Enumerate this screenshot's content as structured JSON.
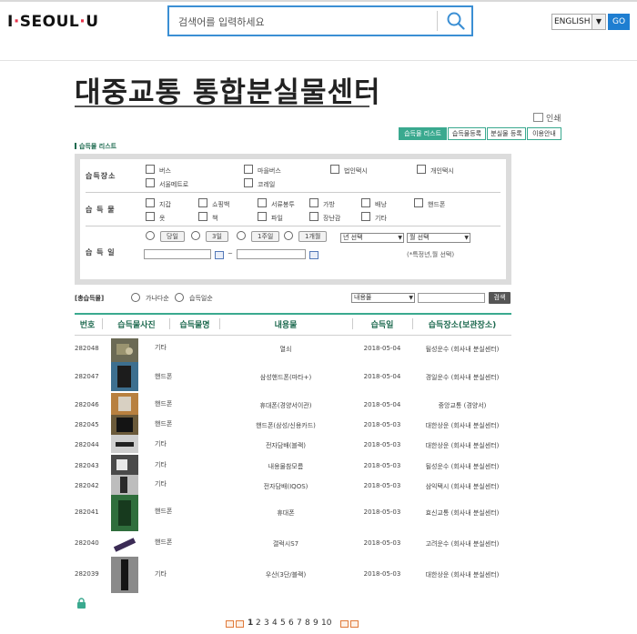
{
  "header": {
    "logo_text": "I·SEOUL·U",
    "logo_i": "I",
    "logo_seoul": "SEOUL",
    "logo_u": "U",
    "search_placeholder": "검색어를 입력하세요",
    "language": "ENGLISH",
    "go_label": "GO"
  },
  "page": {
    "title": "대중교통 통합분실물센터",
    "print_label": "인쇄",
    "section_label": "습득물 리스트"
  },
  "tabs": [
    {
      "label": "습득물 리스트",
      "active": true
    },
    {
      "label": "습득물등록",
      "active": false
    },
    {
      "label": "분실물 등록",
      "active": false
    },
    {
      "label": "이용안내",
      "active": false
    }
  ],
  "search": {
    "place_label": "습득장소",
    "places": [
      "버스",
      "마을버스",
      "법인택시",
      "개인택시",
      "서울메트로",
      "코레일"
    ],
    "item_label": "습 득 물",
    "items": [
      "지갑",
      "쇼핑백",
      "서류봉투",
      "가방",
      "배낭",
      "핸드폰",
      "옷",
      "책",
      "파일",
      "장난감",
      "기타"
    ],
    "date_label": "습 득 일",
    "date_options": [
      "당일",
      "3일",
      "1주일",
      "1개월"
    ],
    "year_select": "년 선택",
    "month_select": "월 선택",
    "tilde": "~",
    "hint": "(*특정년,월 선택)"
  },
  "filter": {
    "label": "[총습득물]",
    "sort_options": [
      "가나다순",
      "습득일순"
    ],
    "type_select": "내용물",
    "search_button": "검색"
  },
  "table": {
    "headers": [
      "번호",
      "습득물사진",
      "습득물명",
      "내용물",
      "습득일",
      "습득장소(보관장소)"
    ],
    "rows": [
      {
        "no": "282048",
        "name": "기타",
        "content": "열쇠",
        "date": "2018-05-04",
        "place": "될성운수 (회사내 분실센터)"
      },
      {
        "no": "282047",
        "name": "핸드폰",
        "content": "삼성핸드폰(마타+)",
        "date": "2018-05-04",
        "place": "경일운수 (회사내 분실센터)"
      },
      {
        "no": "282046",
        "name": "핸드폰",
        "content": "휴대폰(경양서이관)",
        "date": "2018-05-04",
        "place": "중앙교통 (경양서)"
      },
      {
        "no": "282045",
        "name": "핸드폰",
        "content": "핸드폰(삼성/신용카드)",
        "date": "2018-05-03",
        "place": "대한상운 (회사내 분실센터)"
      },
      {
        "no": "282044",
        "name": "기타",
        "content": "전자담배(블랙)",
        "date": "2018-05-03",
        "place": "대한상운 (회사내 분실센터)"
      },
      {
        "no": "282043",
        "name": "기타",
        "content": "내용물참모름",
        "date": "2018-05-03",
        "place": "될성운수 (회사내 분실센터)"
      },
      {
        "no": "282042",
        "name": "기타",
        "content": "전자담배(IQOS)",
        "date": "2018-05-03",
        "place": "삼익택시 (회사내 분실센터)"
      },
      {
        "no": "282041",
        "name": "핸드폰",
        "content": "휴대폰",
        "date": "2018-05-03",
        "place": "효신교통 (회사내 분실센터)"
      },
      {
        "no": "282040",
        "name": "핸드폰",
        "content": "갤럭시S7",
        "date": "2018-05-03",
        "place": "고려운수 (회사내 분실센터)"
      },
      {
        "no": "282039",
        "name": "기타",
        "content": "우산(3단/블랙)",
        "date": "2018-05-03",
        "place": "대한상운 (회사내 분실센터)"
      }
    ]
  },
  "pagination": {
    "pages": [
      "1",
      "2",
      "3",
      "4",
      "5",
      "6",
      "7",
      "8",
      "9",
      "10"
    ],
    "current": "1"
  },
  "colors": {
    "accent": "#3aa98f",
    "dark_green": "#1d6a4f",
    "search_border": "#3b8fd4",
    "go_button": "#1e7ed1",
    "logo_dot": "#e7334a"
  }
}
